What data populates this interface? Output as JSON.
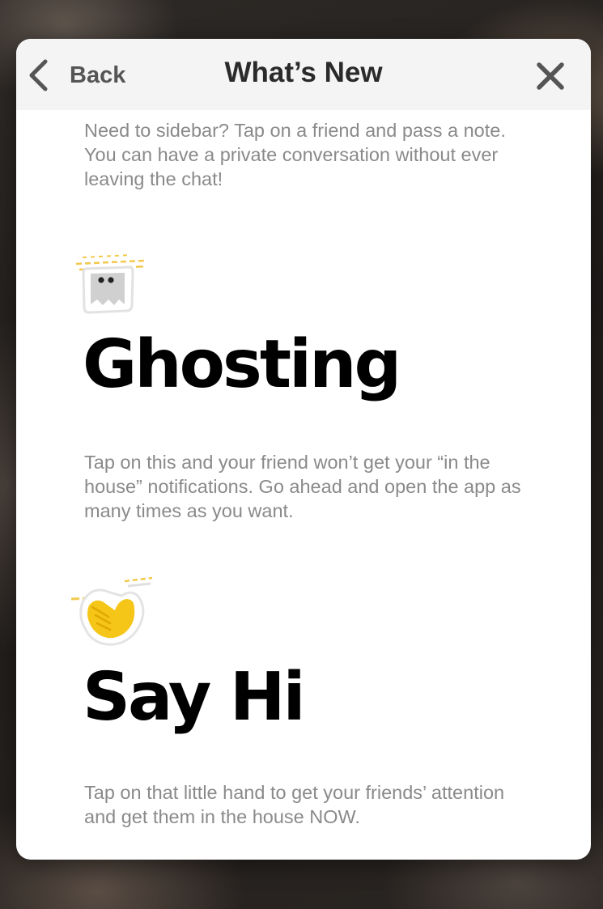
{
  "header": {
    "back_label": "Back",
    "title": "What’s New",
    "back_icon": "chevron-left-icon",
    "close_icon": "close-icon"
  },
  "sections": [
    {
      "body": "Need to sidebar? Tap on a friend and pass a note. You can have a private conversation without ever leaving the chat!"
    },
    {
      "icon": "ghost-icon",
      "title": "Ghosting",
      "body": "Tap on this and your friend won’t get your “in the house” notifications. Go ahead and open the app as many times as you want."
    },
    {
      "icon": "waving-hand-icon",
      "title": "Say Hi",
      "body": "Tap on that little hand to get your friends’ attention and get them in the house NOW."
    }
  ],
  "colors": {
    "header_bg": "#f4f4f4",
    "body_text": "#8a8a8a",
    "accent_yellow": "#f5c518"
  }
}
